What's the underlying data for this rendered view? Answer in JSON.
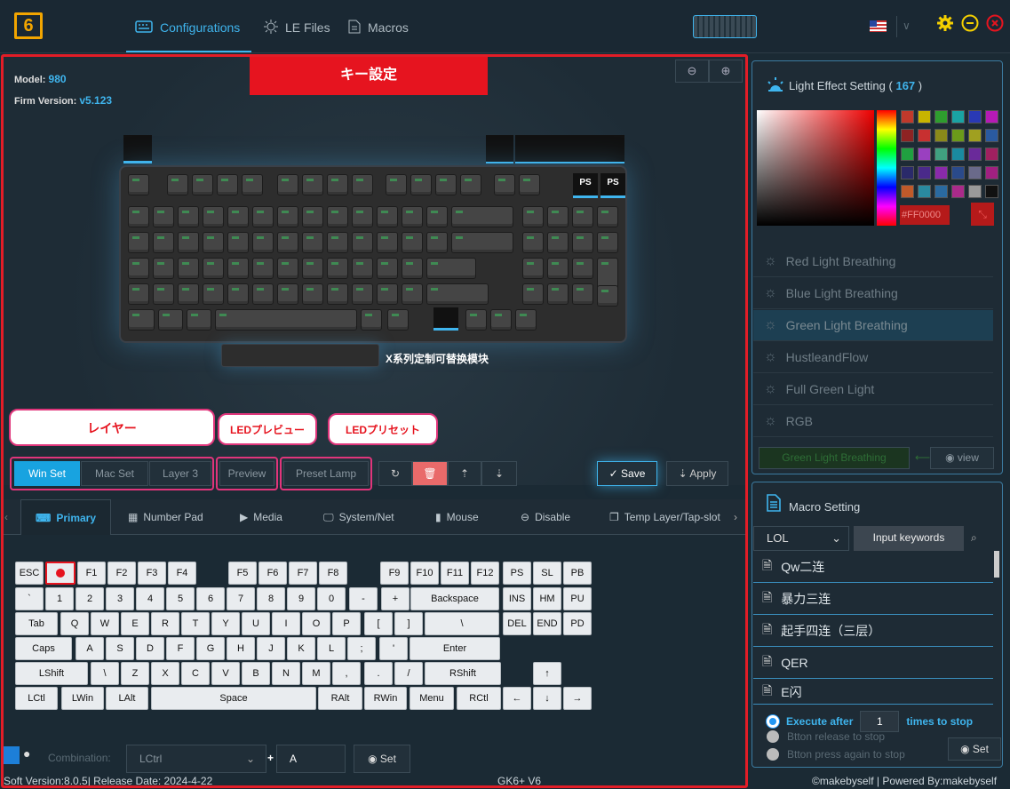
{
  "app": {
    "logo_text": "6"
  },
  "nav": {
    "tabs": [
      {
        "label": "Configurations",
        "icon": "keyboard-icon"
      },
      {
        "label": "LE Files",
        "icon": "sun-icon"
      },
      {
        "label": "Macros",
        "icon": "document-icon"
      }
    ]
  },
  "window_controls": {
    "settings_icon": "gear-icon",
    "minimize_icon": "minimize-icon",
    "close_icon": "close-icon",
    "language": "US"
  },
  "device": {
    "model_label": "Model:",
    "model": "980",
    "firm_label": "Firm Version:",
    "firmware": "v5.123"
  },
  "annotation": {
    "banner": "キー設定",
    "layer": "レイヤー",
    "led_preview": "LEDプレビュー",
    "led_preset": "LEDプリセット"
  },
  "keyboard": {
    "ps_labels": [
      "PS",
      "PS"
    ],
    "module_note": "X系列定制可替换模块"
  },
  "layers": {
    "items": [
      "Win Set",
      "Mac Set",
      "Layer 3"
    ],
    "active": "Win Set"
  },
  "toolbar": {
    "preview": "Preview",
    "preset": "Preset Lamp",
    "save": "Save",
    "apply": "Apply"
  },
  "categories": {
    "items": [
      "Primary",
      "Number Pad",
      "Media",
      "System/Net",
      "Mouse",
      "Disable",
      "Temp Layer/Tap-slot"
    ],
    "active": "Primary"
  },
  "vkeys": {
    "row0": [
      "ESC",
      "",
      "F1",
      "F2",
      "F3",
      "F4",
      "F5",
      "F6",
      "F7",
      "F8",
      "F9",
      "F10",
      "F11",
      "F12",
      "PS",
      "SL",
      "PB"
    ],
    "row1": [
      "`",
      "1",
      "2",
      "3",
      "4",
      "5",
      "6",
      "7",
      "8",
      "9",
      "0",
      "-",
      "+",
      "Backspace",
      "INS",
      "HM",
      "PU"
    ],
    "row2": [
      "Tab",
      "Q",
      "W",
      "E",
      "R",
      "T",
      "Y",
      "U",
      "I",
      "O",
      "P",
      "[",
      "]",
      "\\",
      "DEL",
      "END",
      "PD"
    ],
    "row3": [
      "Caps",
      "A",
      "S",
      "D",
      "F",
      "G",
      "H",
      "J",
      "K",
      "L",
      ";",
      "'",
      "Enter"
    ],
    "row4": [
      "LShift",
      "\\",
      "Z",
      "X",
      "C",
      "V",
      "B",
      "N",
      "M",
      ",",
      ".",
      "/",
      "RShift",
      "↑"
    ],
    "row5": [
      "LCtl",
      "LWin",
      "LAlt",
      "Space",
      "RAlt",
      "RWin",
      "Menu",
      "RCtl",
      "←",
      "↓",
      "→"
    ]
  },
  "combination": {
    "label": "Combination:",
    "modifier": "LCtrl",
    "plus": "+",
    "key": "A",
    "set": "Set"
  },
  "status": {
    "soft": "Soft Version:8.0.5| Release Date: 2024-4-22",
    "device": "GK6+ V6",
    "credit": "©makebyself | Powered By:makebyself"
  },
  "light": {
    "title": "Light Effect Setting (",
    "count": "167",
    "close": ")",
    "hex": "#FF0000",
    "palette": [
      "#c0392b",
      "#c8b400",
      "#2e9d2e",
      "#1aa3a3",
      "#2939b5",
      "#b51ab5",
      "#8e2323",
      "#c83030",
      "#8a8a1a",
      "#6b9a1a",
      "#a0a020",
      "#2a5aa0",
      "#20a040",
      "#9a40c0",
      "#40a080",
      "#1a8aa0",
      "#6a2a9a",
      "#a02060",
      "#2a2a6a",
      "#4a2a8a",
      "#8a2aaa",
      "#2a4a8a",
      "#6a6a8a",
      "#a02080",
      "#c05a2a",
      "#2a8aa0",
      "#2a6aa0",
      "#aa2a8a",
      "#9a9a9a",
      "#111111"
    ],
    "effects": [
      "Red Light Breathing",
      "Blue Light Breathing",
      "Green Light Breathing",
      "HustleandFlow",
      "Full Green Light",
      "RGB"
    ],
    "selected": "Green Light Breathing",
    "current": "Green Light Breathing",
    "view": "view"
  },
  "macro": {
    "title": "Macro Setting",
    "game": "LOL",
    "search": "Input keywords",
    "items": [
      "Qw二连",
      "暴力三连",
      "起手四连（三层）",
      "QER",
      "E闪"
    ],
    "execute_prefix": "Execute after",
    "count": "1",
    "execute_suffix": "times to stop",
    "opt2": "Btton release to stop",
    "opt3": "Btton press again to stop",
    "set": "Set"
  }
}
